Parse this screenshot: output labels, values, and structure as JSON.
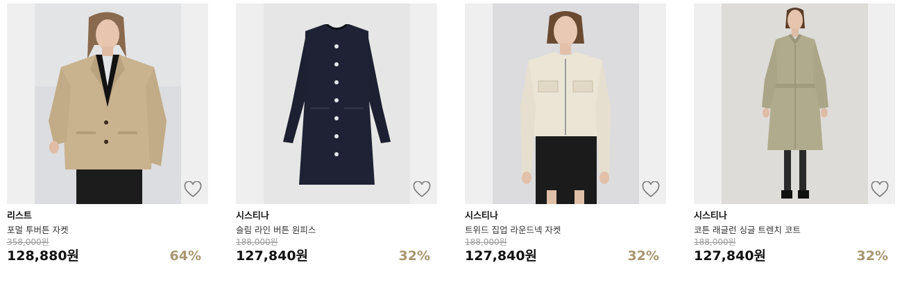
{
  "products": [
    {
      "brand": "리스트",
      "name": "포멀 투버튼 자켓",
      "original_price": "358,000원",
      "sale_price": "128,880원",
      "discount": "64%",
      "image": "woman-in-beige-blazer",
      "wishlist_icon": "heart-outline"
    },
    {
      "brand": "시스티나",
      "name": "슬림 라인 버튼 원피스",
      "original_price": "188,000원",
      "sale_price": "127,840원",
      "discount": "32%",
      "image": "navy-buttoned-dress",
      "wishlist_icon": "heart-outline"
    },
    {
      "brand": "시스티나",
      "name": "트위드 집업 라운드넥 자켓",
      "original_price": "188,000원",
      "sale_price": "127,840원",
      "discount": "32%",
      "image": "woman-in-ivory-tweed-jacket",
      "wishlist_icon": "heart-outline"
    },
    {
      "brand": "시스티나",
      "name": "코튼 래글런 싱글 트렌치 코트",
      "original_price": "188,000원",
      "sale_price": "127,840원",
      "discount": "32%",
      "image": "woman-in-khaki-trench-coat",
      "wishlist_icon": "heart-outline"
    }
  ],
  "colors": {
    "discount": "#a7966f",
    "original_price": "#9a9a9a",
    "thumb_bg": "#efefef"
  }
}
